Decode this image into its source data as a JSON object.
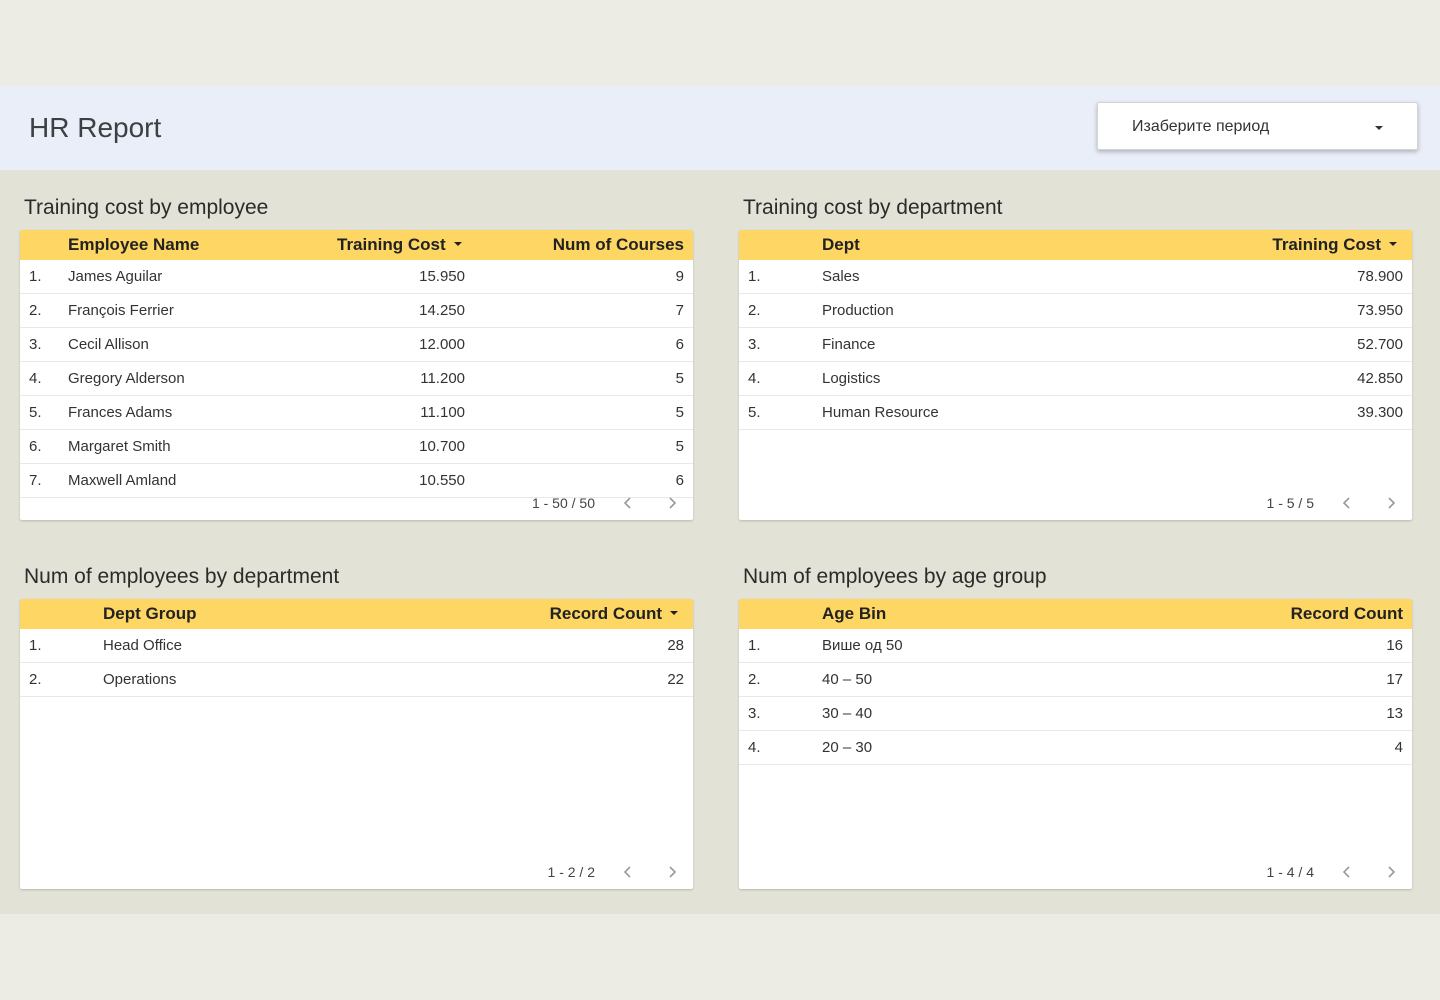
{
  "header": {
    "title": "HR Report",
    "period_label": "Изаберите период"
  },
  "panels": {
    "training_by_employee": {
      "title": "Training cost by employee",
      "columns": [
        "Employee Name",
        "Training Cost",
        "Num of Courses"
      ],
      "rows": [
        [
          "1.",
          "James Aguilar",
          "15.950",
          "9"
        ],
        [
          "2.",
          "François Ferrier",
          "14.250",
          "7"
        ],
        [
          "3.",
          "Cecil Allison",
          "12.000",
          "6"
        ],
        [
          "4.",
          "Gregory Alderson",
          "11.200",
          "5"
        ],
        [
          "5.",
          "Frances Adams",
          "11.100",
          "5"
        ],
        [
          "6.",
          "Margaret Smith",
          "10.700",
          "5"
        ],
        [
          "7.",
          "Maxwell Amland",
          "10.550",
          "6"
        ]
      ],
      "pager": "1 - 50 / 50"
    },
    "training_by_department": {
      "title": "Training cost by department",
      "columns": [
        "Dept",
        "Training Cost"
      ],
      "rows": [
        [
          "1.",
          "Sales",
          "78.900"
        ],
        [
          "2.",
          "Production",
          "73.950"
        ],
        [
          "3.",
          "Finance",
          "52.700"
        ],
        [
          "4.",
          "Logistics",
          "42.850"
        ],
        [
          "5.",
          "Human Resource",
          "39.300"
        ]
      ],
      "pager": "1 - 5 / 5"
    },
    "employees_by_department": {
      "title": "Num of employees by department",
      "columns": [
        "Dept Group",
        "Record Count"
      ],
      "rows": [
        [
          "1.",
          "Head Office",
          "28"
        ],
        [
          "2.",
          "Operations",
          "22"
        ]
      ],
      "pager": "1 - 2 / 2"
    },
    "employees_by_age": {
      "title": "Num of employees by age group",
      "columns": [
        "Age Bin",
        "Record Count"
      ],
      "rows": [
        [
          "1.",
          "Више од 50",
          "16"
        ],
        [
          "2.",
          "40 – 50",
          "17"
        ],
        [
          "3.",
          "30 – 40",
          "13"
        ],
        [
          "4.",
          "20 – 30",
          "4"
        ]
      ],
      "pager": "1 - 4 / 4"
    }
  },
  "colors": {
    "header_band": "#e9eef8",
    "canvas": "#e2e2d6",
    "table_header": "#fdd663"
  },
  "icons": [
    "caret-down-icon",
    "chevron-left-icon",
    "chevron-right-icon",
    "sort-desc-icon"
  ]
}
